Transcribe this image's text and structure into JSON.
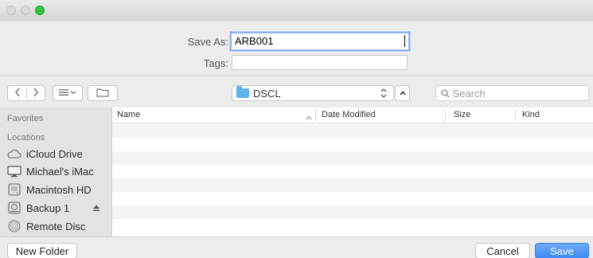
{
  "dialog": {
    "save_as_label": "Save As:",
    "save_as_value": "ARB001",
    "tags_label": "Tags:",
    "tags_value": ""
  },
  "toolbar": {
    "back_icon": "chevron-left-icon",
    "forward_icon": "chevron-right-icon",
    "view_icon": "list-view-icon",
    "new_folder_icon": "folder-add-icon",
    "location": "DSCL",
    "search_placeholder": "Search"
  },
  "sidebar": {
    "favorites_header": "Favorites",
    "locations_header": "Locations",
    "items": [
      {
        "label": "iCloud Drive",
        "icon": "cloud-icon"
      },
      {
        "label": "Michael's iMac",
        "icon": "monitor-icon"
      },
      {
        "label": "Macintosh HD",
        "icon": "hard-drive-icon"
      },
      {
        "label": "Backup 1",
        "icon": "external-drive-icon"
      },
      {
        "label": "Remote Disc",
        "icon": "disc-icon"
      }
    ]
  },
  "file_list": {
    "columns": [
      "Name",
      "Date Modified",
      "Size",
      "Kind"
    ],
    "rows": []
  },
  "buttons": {
    "new_folder": "New Folder",
    "cancel": "Cancel",
    "save": "Save"
  },
  "colors": {
    "accent": "#3f8cf5",
    "folder": "#5cb4ec",
    "window_control_green": "#2cc53e"
  }
}
